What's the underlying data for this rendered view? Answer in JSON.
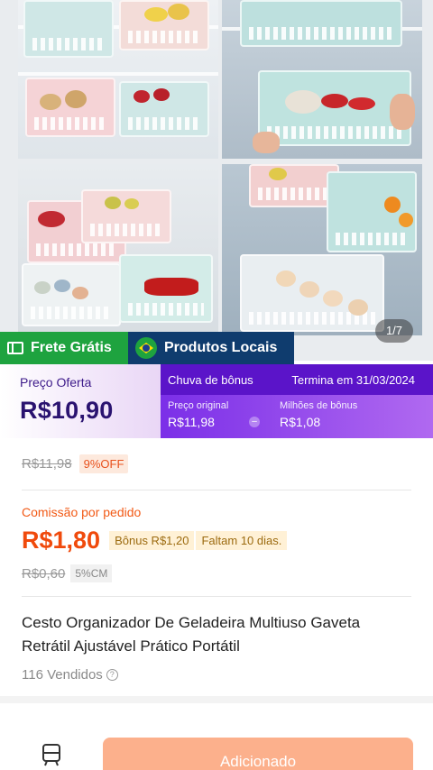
{
  "gallery": {
    "counter": "1/7"
  },
  "badges": {
    "free_shipping": "Frete Grátis",
    "local_products": "Produtos Locais"
  },
  "price_banner": {
    "offer_label": "Preço Oferta",
    "offer_price": "R$10,90",
    "bonus_title": "Chuva de bônus",
    "bonus_end": "Termina em 31/03/2024",
    "original_caption": "Preço original",
    "original_value": "R$11,98",
    "bonus_caption": "Milhões de bônus",
    "bonus_value": "R$1,08"
  },
  "pricing": {
    "old_price": "R$11,98",
    "discount": "9%OFF",
    "commission_label": "Comissão por pedido",
    "commission_price": "R$1,80",
    "bonus_tag": "Bônus R$1,20",
    "days_left_tag": "Faltam 10 dias.",
    "old_commission": "R$0,60",
    "cm_tag": "5%CM"
  },
  "product": {
    "title": "Cesto Organizador De Geladeira Multiuso Gaveta Retrátil Ajustável Prático Portátil",
    "sold": "116 Vendidos"
  },
  "bottom_bar": {
    "store_icon": "store-icon",
    "add_button": "Adicionado"
  },
  "colors": {
    "free_shipping_bg": "#1ea33f",
    "local_products_bg": "#0f3c6e",
    "bonus_bg": "#7b2fe8",
    "commission_orange": "#f04a0c",
    "add_button_bg": "#fcb08c"
  }
}
